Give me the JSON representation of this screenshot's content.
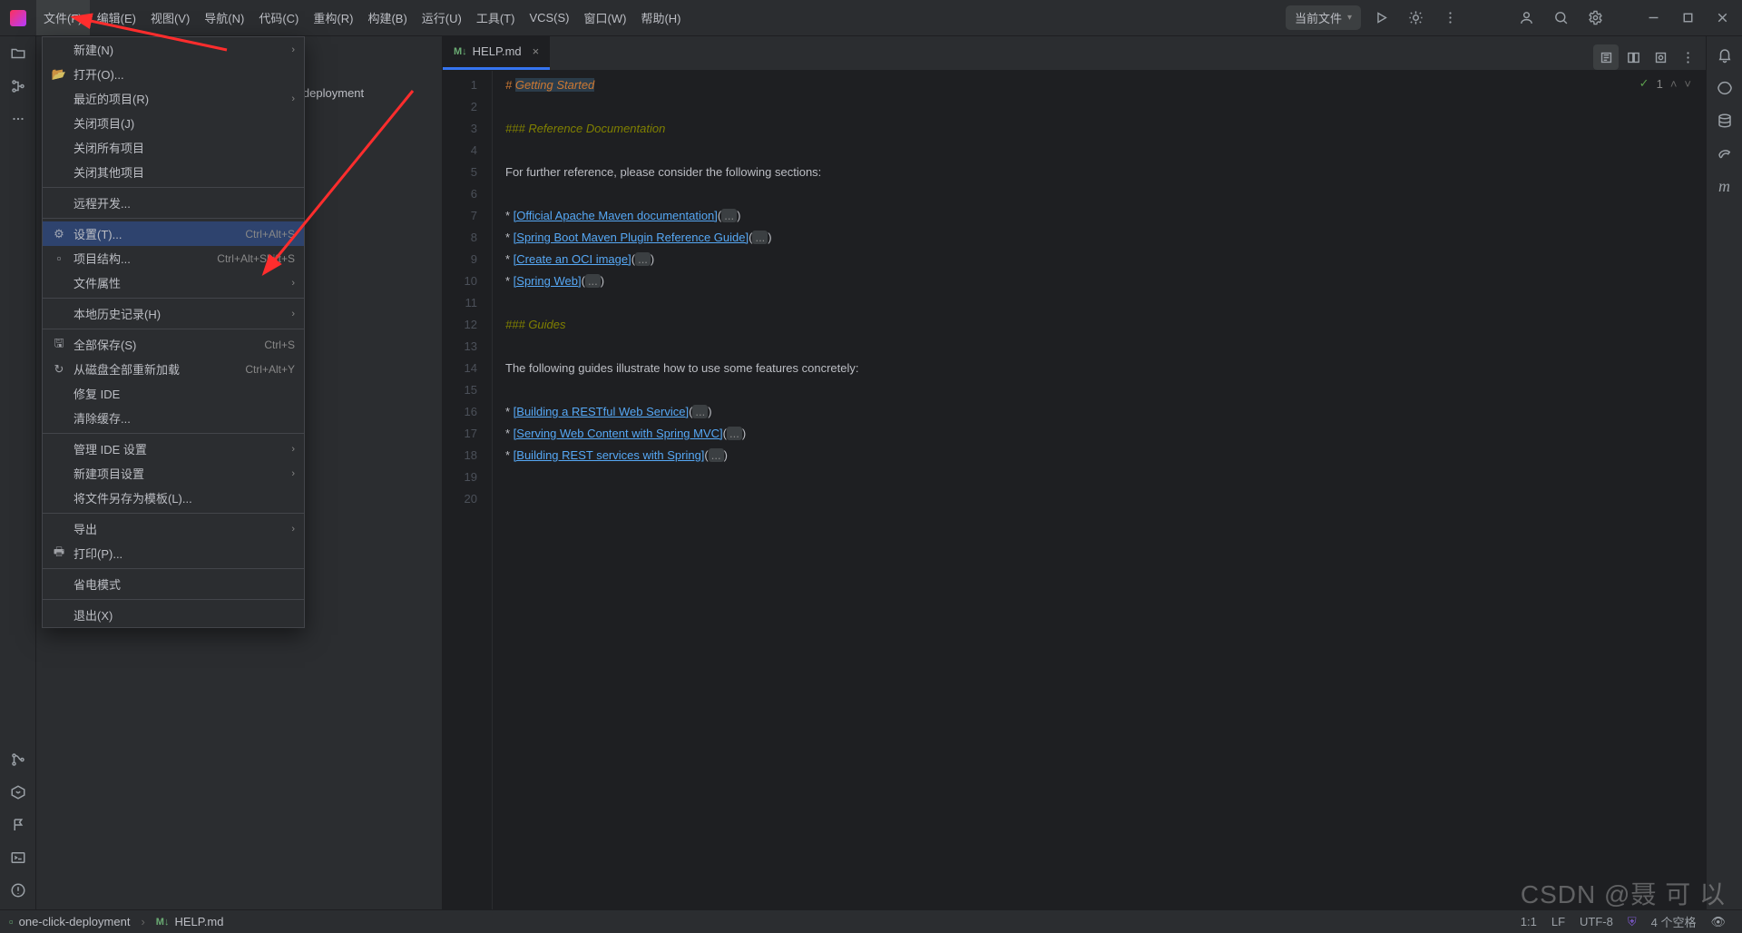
{
  "menubar": [
    "文件(F)",
    "编辑(E)",
    "视图(V)",
    "导航(N)",
    "代码(C)",
    "重构(R)",
    "构建(B)",
    "运行(U)",
    "工具(T)",
    "VCS(S)",
    "窗口(W)",
    "帮助(H)"
  ],
  "titlebar": {
    "current_file": "当前文件"
  },
  "dropdown": {
    "new": "新建(N)",
    "open": "打开(O)...",
    "recent": "最近的项目(R)",
    "close_project": "关闭项目(J)",
    "close_all": "关闭所有项目",
    "close_other": "关闭其他项目",
    "remote": "远程开发...",
    "settings": "设置(T)...",
    "settings_sc": "Ctrl+Alt+S",
    "project_struct": "项目结构...",
    "project_struct_sc": "Ctrl+Alt+Shift+S",
    "file_props": "文件属性",
    "local_history": "本地历史记录(H)",
    "save_all": "全部保存(S)",
    "save_all_sc": "Ctrl+S",
    "reload": "从磁盘全部重新加载",
    "reload_sc": "Ctrl+Alt+Y",
    "repair": "修复 IDE",
    "clear_cache": "清除缓存...",
    "manage_ide": "管理 IDE 设置",
    "new_proj_settings": "新建项目设置",
    "save_template": "将文件另存为模板(L)...",
    "export": "导出",
    "print": "打印(P)...",
    "power_save": "省电模式",
    "exit": "退出(X)"
  },
  "project": {
    "name_fragment": "-click-deployment"
  },
  "tab": {
    "label": "HELP.md"
  },
  "code": {
    "l1_a": "# ",
    "l1_b": "Getting Started",
    "l3_a": "### ",
    "l3_b": "Reference Documentation",
    "l5": "For further reference, please consider the following sections:",
    "star": "* ",
    "l7_link": "[Official Apache Maven documentation]",
    "l8_link": "[Spring Boot Maven Plugin Reference Guide]",
    "l9_link": "[Create an OCI image]",
    "l10_link": "[Spring Web]",
    "l12_a": "### ",
    "l12_b": "Guides",
    "l14": "The following guides illustrate how to use some features concretely:",
    "l16_link": "[Building a RESTful Web Service]",
    "l17_link": "[Serving Web Content with Spring MVC]",
    "l18_link": "[Building REST services with Spring]",
    "open": "(",
    "close": ")",
    "fold": "..."
  },
  "inspect": {
    "icon": "✓",
    "count": "1"
  },
  "breadcrumb": {
    "proj": "one-click-deployment",
    "file": "HELP.md",
    "md": "M↓"
  },
  "status": {
    "pos": "1:1",
    "le": "LF",
    "enc": "UTF-8",
    "indent": "4 个空格"
  },
  "watermark": "CSDN @聂 可 以"
}
